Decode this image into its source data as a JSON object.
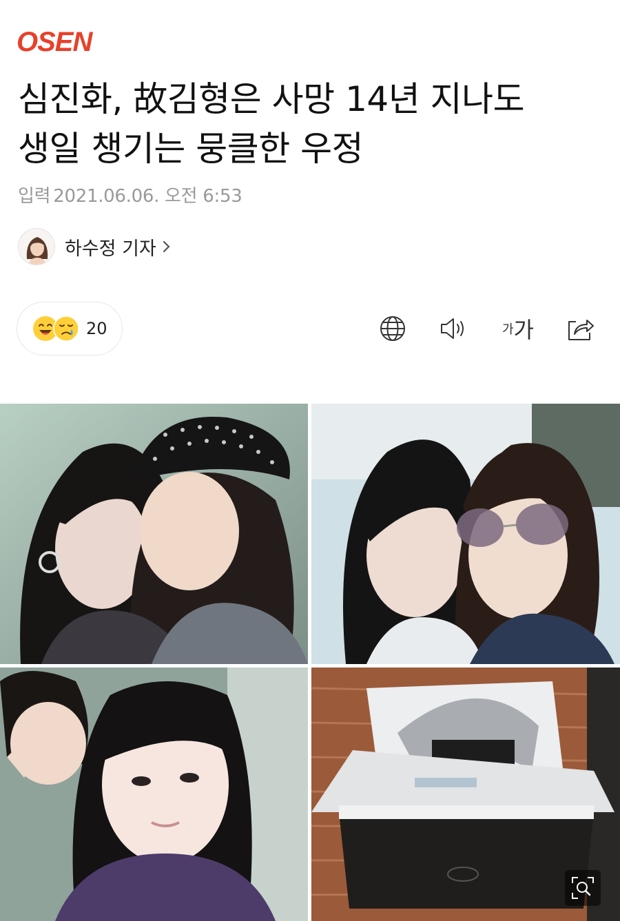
{
  "brand": {
    "logo_text": "OSEN",
    "logo_color": "#e8402a"
  },
  "article": {
    "headline_line1": "심진화, 故김형은 사망 14년 지나도",
    "headline_line2": "생일 챙기는 뭉클한 우정",
    "date_label": "입력",
    "date_value": "2021.06.06. 오전 6:53"
  },
  "reporter": {
    "name": "하수정 기자"
  },
  "reactions": {
    "count": "20",
    "icons": [
      "smile-emoji",
      "sad-emoji"
    ]
  },
  "toolbar": {
    "translate_icon": "globe-icon",
    "listen_icon": "speaker-icon",
    "font_small": "가",
    "font_large": "가",
    "share_icon": "share-icon"
  },
  "photo": {
    "icons": [
      "zoom-icon"
    ]
  },
  "colors": {
    "text_primary": "#111111",
    "text_muted": "#999999",
    "border": "#e6e6e6"
  }
}
